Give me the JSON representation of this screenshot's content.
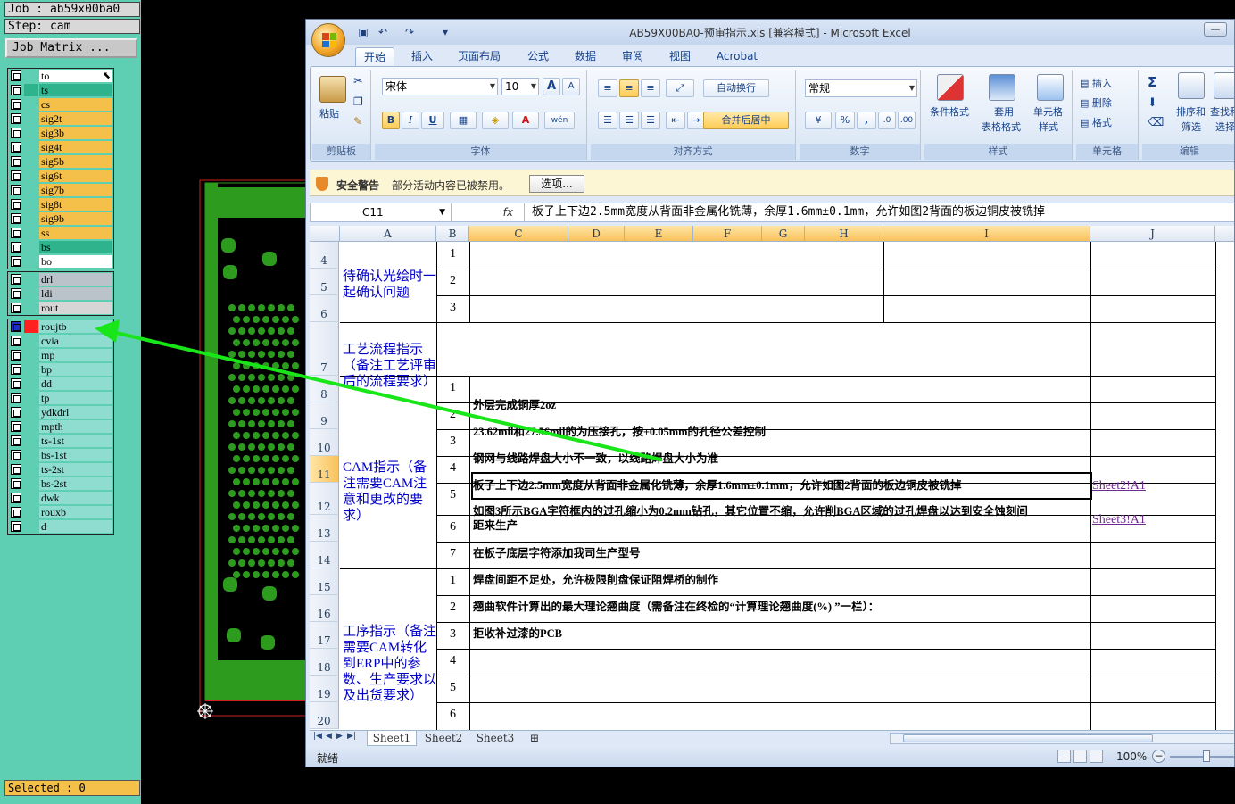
{
  "cam": {
    "job": "Job : ab59x00ba0",
    "step": "Step: cam",
    "job_matrix": "Job Matrix ...",
    "selected": "Selected : 0",
    "groups": [
      {
        "layers": [
          {
            "name": "to",
            "fill": "#ffffff",
            "mark": "",
            "pointer": true
          },
          {
            "name": "ts",
            "fill": "#2fb38c",
            "mark": "#2fb38c"
          },
          {
            "name": "cs",
            "fill": "#f4c04a",
            "mark": ""
          },
          {
            "name": "sig2t",
            "fill": "#f4c04a",
            "mark": ""
          },
          {
            "name": "sig3b",
            "fill": "#f4c04a",
            "mark": ""
          },
          {
            "name": "sig4t",
            "fill": "#f4c04a",
            "mark": ""
          },
          {
            "name": "sig5b",
            "fill": "#f4c04a",
            "mark": ""
          },
          {
            "name": "sig6t",
            "fill": "#f4c04a",
            "mark": ""
          },
          {
            "name": "sig7b",
            "fill": "#f4c04a",
            "mark": ""
          },
          {
            "name": "sig8t",
            "fill": "#f4c04a",
            "mark": ""
          },
          {
            "name": "sig9b",
            "fill": "#f4c04a",
            "mark": ""
          },
          {
            "name": "ss",
            "fill": "#f4c04a",
            "mark": ""
          },
          {
            "name": "bs",
            "fill": "#2fb38c",
            "mark": ""
          },
          {
            "name": "bo",
            "fill": "#ffffff",
            "mark": ""
          }
        ]
      },
      {
        "layers": [
          {
            "name": "drl",
            "fill": "#b9c3c9",
            "mark": ""
          },
          {
            "name": "ldi",
            "fill": "#b9c3c9",
            "mark": ""
          },
          {
            "name": "rout",
            "fill": "#d6d6d6",
            "mark": ""
          }
        ]
      },
      {
        "layers": [
          {
            "name": "roujtb",
            "fill": "#8fdcd0",
            "mark": "#ff2020",
            "active": true
          },
          {
            "name": "cvia",
            "fill": "#8fdcd0",
            "mark": ""
          },
          {
            "name": "mp",
            "fill": "#8fdcd0",
            "mark": ""
          },
          {
            "name": "bp",
            "fill": "#8fdcd0",
            "mark": ""
          },
          {
            "name": "dd",
            "fill": "#8fdcd0",
            "mark": ""
          },
          {
            "name": "tp",
            "fill": "#8fdcd0",
            "mark": ""
          },
          {
            "name": "ydkdrl",
            "fill": "#8fdcd0",
            "mark": ""
          },
          {
            "name": "mpth",
            "fill": "#8fdcd0",
            "mark": ""
          },
          {
            "name": "ts-1st",
            "fill": "#8fdcd0",
            "mark": ""
          },
          {
            "name": "bs-1st",
            "fill": "#8fdcd0",
            "mark": ""
          },
          {
            "name": "ts-2st",
            "fill": "#8fdcd0",
            "mark": ""
          },
          {
            "name": "bs-2st",
            "fill": "#8fdcd0",
            "mark": ""
          },
          {
            "name": "dwk",
            "fill": "#8fdcd0",
            "mark": ""
          },
          {
            "name": "rouxb",
            "fill": "#8fdcd0",
            "mark": ""
          },
          {
            "name": "d",
            "fill": "#8fdcd0",
            "mark": ""
          }
        ]
      }
    ]
  },
  "excel": {
    "title": "AB59X00BA0-预审指示.xls [兼容模式] - Microsoft Excel",
    "tabs": [
      "开始",
      "插入",
      "页面布局",
      "公式",
      "数据",
      "审阅",
      "视图",
      "Acrobat"
    ],
    "ribbon": {
      "clipboard": {
        "label": "剪贴板",
        "paste": "粘贴"
      },
      "font": {
        "label": "字体",
        "name": "宋体",
        "size": "10",
        "bold": "B",
        "italic": "I",
        "underline": "U",
        "grow": "A",
        "shrink": "A"
      },
      "align": {
        "label": "对齐方式",
        "wrap": "自动换行",
        "merge": "合并后居中"
      },
      "number": {
        "label": "数字",
        "format": "常规",
        "percent": "%",
        "comma": ","
      },
      "styles": {
        "label": "样式",
        "cond": "条件格式",
        "table1": "套用",
        "table2": "表格格式",
        "cell1": "单元格",
        "cell2": "样式"
      },
      "cells": {
        "label": "单元格",
        "insert": "插入",
        "delete": "删除",
        "format": "格式"
      },
      "edit": {
        "label": "编辑",
        "sum": "Σ",
        "sort1": "排序和",
        "sort2": "筛选",
        "find1": "查找和",
        "find2": "选择"
      }
    },
    "security": {
      "title": "安全警告",
      "message": "部分活动内容已被禁用。",
      "options": "选项..."
    },
    "formula": {
      "cell": "C11",
      "fx": "fx",
      "content": "板子上下边2.5mm宽度从背面非金属化铣薄，余厚1.6mm±0.1mm，允许如图2背面的板边铜皮被铣掉"
    },
    "columns": [
      "A",
      "B",
      "C",
      "D",
      "E",
      "F",
      "G",
      "H",
      "I",
      "J"
    ],
    "rows": [
      "4",
      "5",
      "6",
      "7",
      "8",
      "9",
      "10",
      "11",
      "12",
      "13",
      "14",
      "15",
      "16",
      "17",
      "18",
      "19",
      "20"
    ],
    "categories": {
      "confirm": "待确认光绘时一起确认问题",
      "process": "工艺流程指示（备注工艺评审后的流程要求）",
      "cam": "CAM指示（备注需要CAM注意和更改的要求）",
      "workflow": "工序指示（备注需要CAM转化到ERP中的参数、生产要求以及出货要求）"
    },
    "numbers": [
      "1",
      "2",
      "3",
      "1",
      "2",
      "3",
      "4",
      "5",
      "6",
      "7",
      "1",
      "2",
      "3",
      "4",
      "5",
      "6"
    ],
    "lines": [
      "外层完成铜厚2oz",
      "23.62mil和27.56mil的为压接孔，按±0.05mm的孔径公差控制",
      "钢网与线路焊盘大小不一致，以线路焊盘大小为准",
      "板子上下边2.5mm宽度从背面非金属化铣薄，余厚1.6mm±0.1mm，允许如图2背面的板边铜皮被铣掉",
      "如图3所示BGA字符框内的过孔缩小为0.2mm钻孔，其它位置不缩，允许削BGA区域的过孔焊盘以达到安全蚀刻间",
      "距来生产",
      "在板子底层字符添加我司生产型号",
      "焊盘间距不足处，允许极限削盘保证阻焊桥的制作",
      "翘曲软件计算出的最大理论翘曲度（需备注在终检的“计算理论翘曲度(%) ”一栏）：",
      "拒收补过漆的PCB"
    ],
    "links": [
      "Sheet2!A1",
      "Sheet3!A1"
    ],
    "sheets": [
      "Sheet1",
      "Sheet2",
      "Sheet3"
    ],
    "status": "就绪",
    "zoom": "100%"
  },
  "colors": {
    "cam_bg": "#5fcfb3",
    "pcb_green": "#2d9b1e",
    "arrow": "#19e619",
    "excel_accent": "#15428b"
  }
}
